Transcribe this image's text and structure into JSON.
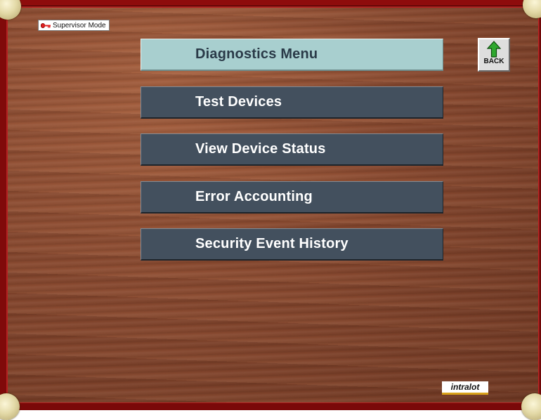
{
  "supervisor": {
    "label": "Supervisor Mode",
    "icon": "key-icon"
  },
  "menu": {
    "title": "Diagnostics Menu",
    "items": [
      {
        "label": "Test Devices"
      },
      {
        "label": "View Device Status"
      },
      {
        "label": "Error Accounting"
      },
      {
        "label": "Security Event History"
      }
    ]
  },
  "back": {
    "label": "BACK",
    "icon": "up-arrow-icon",
    "arrow_color": "#2fa82f"
  },
  "brand": {
    "logo_text": "intralot"
  },
  "colors": {
    "frame": "#8e0c0c",
    "button": "#43505e",
    "title_button": "#a8cfcf",
    "logo_underline": "#d9a21a"
  }
}
